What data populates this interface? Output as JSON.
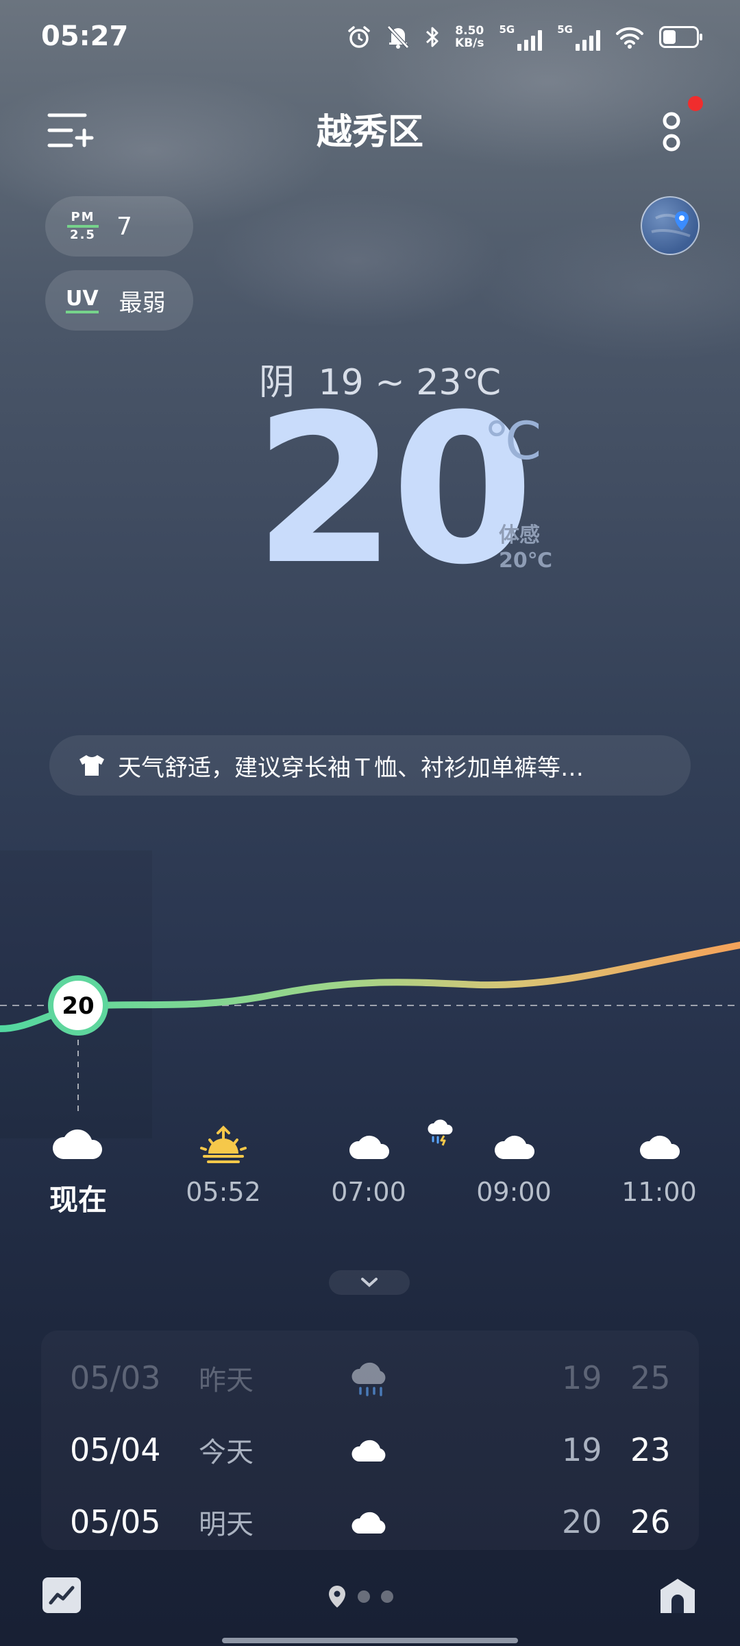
{
  "status_bar": {
    "time": "05:27",
    "net_speed_value": "8.50",
    "net_speed_unit": "KB/s",
    "sim1_label": "5G",
    "sim2_label": "5G",
    "icons": [
      "alarm-icon",
      "mute-bell-icon",
      "bluetooth-icon",
      "signal-icon",
      "signal-icon",
      "wifi-icon",
      "battery-icon"
    ]
  },
  "header": {
    "title": "越秀区",
    "menu_icon": "add-city-menu-icon",
    "more_icon": "more-vertical-icon",
    "notification_dot_color": "#f02d2d"
  },
  "air": {
    "pm_label_top": "PM",
    "pm_label_bottom": "2.5",
    "pm_value": "7",
    "uv_label": "UV",
    "uv_value": "最弱",
    "accent_color": "#76d38b"
  },
  "current": {
    "condition": "阴",
    "range": "19 ~ 23℃",
    "temp": "20",
    "unit": "℃",
    "feels_label": "体感",
    "feels_value": "20℃"
  },
  "advice": {
    "icon": "tshirt-icon",
    "text": "天气舒适，建议穿长袖Ｔ恤、衬衫加单裤等…"
  },
  "hourly": {
    "now_temp": "20",
    "items": [
      {
        "label": "现在",
        "icon": "cloud-icon"
      },
      {
        "label": "05:52",
        "icon": "sunrise-icon"
      },
      {
        "label": "07:00",
        "icon": "cloud-icon"
      },
      {
        "label": "09:00",
        "icon": "cloud-icon"
      },
      {
        "label": "11:00",
        "icon": "cloud-icon"
      }
    ],
    "extra_icon": "thunderstorm-icon",
    "expand_icon": "chevron-down-icon"
  },
  "daily": [
    {
      "date": "05/03",
      "name": "昨天",
      "icon": "rain-cloud-icon",
      "low": "19",
      "high": "25"
    },
    {
      "date": "05/04",
      "name": "今天",
      "icon": "cloud-icon",
      "low": "19",
      "high": "23"
    },
    {
      "date": "05/05",
      "name": "明天",
      "icon": "cloud-icon",
      "low": "20",
      "high": "26"
    }
  ],
  "bottom_nav": {
    "trend_icon": "trend-chart-icon",
    "location_icon": "location-pin-icon",
    "home_icon": "home-icon"
  }
}
